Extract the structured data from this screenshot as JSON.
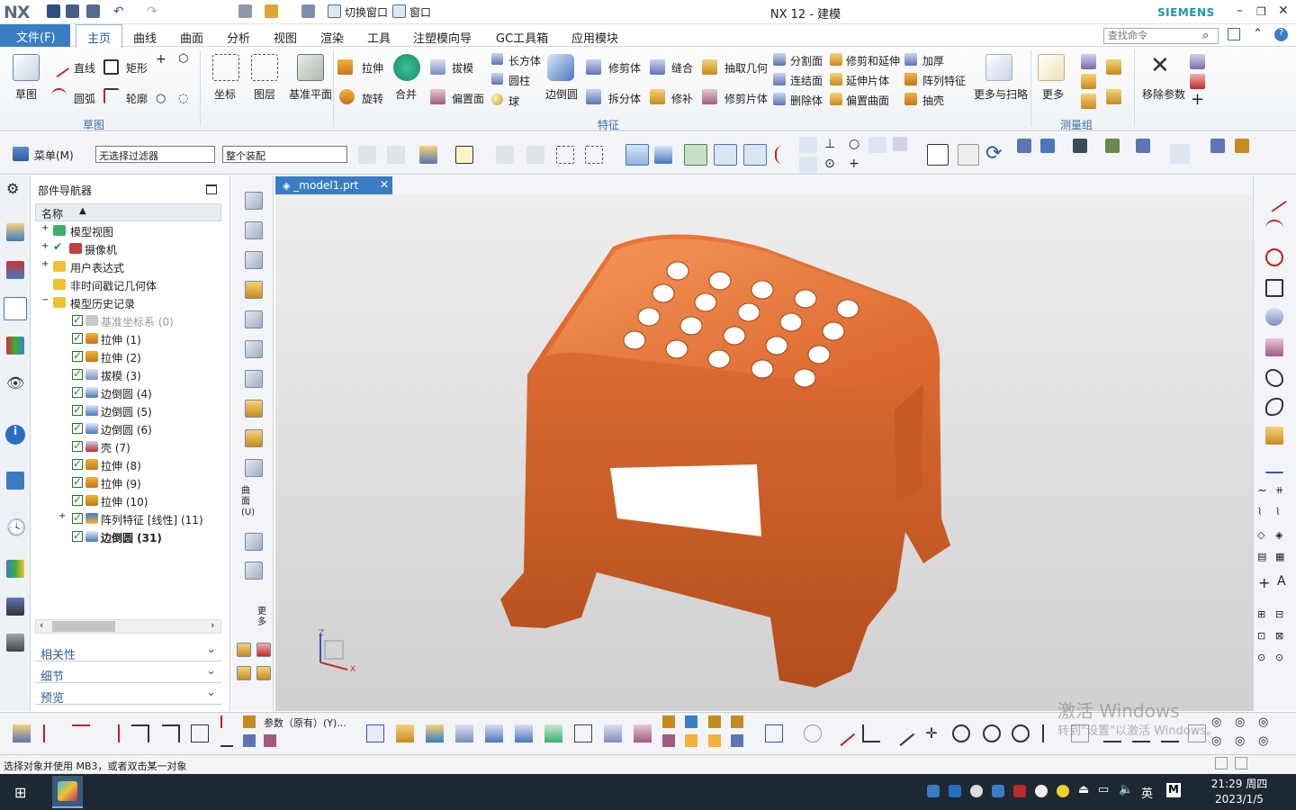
{
  "app": {
    "logo": "NX",
    "title": "NX 12 - 建模",
    "brand": "SIEMENS",
    "switch_window": "切换窗口",
    "window_menu": "窗口"
  },
  "menu": {
    "file": "文件(F)",
    "tabs": [
      "主页",
      "曲线",
      "曲面",
      "分析",
      "视图",
      "渲染",
      "工具",
      "注塑模向导",
      "GC工具箱",
      "应用模块"
    ],
    "search_placeholder": "查找命令"
  },
  "ribbon": {
    "sketch_group": {
      "label": "草图",
      "big": "草图",
      "items": [
        "直线",
        "矩形",
        "圆弧",
        "轮廓"
      ]
    },
    "mid_group": {
      "items": [
        "坐标",
        "图层",
        "基准平面"
      ]
    },
    "feature_group": {
      "label": "特征",
      "items": [
        "拉伸",
        "旋转",
        "合并",
        "拔模",
        "偏置面",
        "长方体",
        "圆柱",
        "球",
        "边倒圆",
        "修剪体",
        "拆分体",
        "缝合",
        "修补",
        "抽取几何",
        "修剪片体",
        "分割面",
        "连结面",
        "删除体",
        "修剪和延伸",
        "延伸片体",
        "偏置曲面",
        "加厚",
        "阵列特征",
        "抽壳",
        "更多与扫略",
        "更多"
      ]
    },
    "measure_group": {
      "label": "测量组",
      "items": [
        "移除参数"
      ]
    }
  },
  "toolbar": {
    "menu": "菜单(M)",
    "filter": "无选择过滤器",
    "assembly": "整个装配"
  },
  "navigator": {
    "title": "部件导航器",
    "column": "名称",
    "roots": [
      "模型视图",
      "摄像机",
      "用户表达式",
      "非时间戳记几何体",
      "模型历史记录"
    ],
    "history": [
      "基准坐标系 (0)",
      "拉伸 (1)",
      "拉伸 (2)",
      "拔模 (3)",
      "边倒圆 (4)",
      "边倒圆 (5)",
      "边倒圆 (6)",
      "壳 (7)",
      "拉伸 (8)",
      "拉伸 (9)",
      "拉伸 (10)",
      "阵列特征 [线性] (11)",
      "边倒圆 (31)"
    ],
    "panels": [
      "相关性",
      "细节",
      "预览"
    ]
  },
  "midbar": {
    "label1": "曲面(U)",
    "label2": "更多"
  },
  "document": {
    "tab": "_model1.prt"
  },
  "bottom": {
    "params": "参数（原有）(Y)..."
  },
  "status": {
    "text": "选择对象并使用 MB3，或者双击某一对象"
  },
  "watermark": {
    "line1": "激活 Windows",
    "line2": "转到\"设置\"以激活 Windows。"
  },
  "axis": {
    "z": "Z",
    "x": "X"
  },
  "taskbar": {
    "time": "21:29 周四",
    "date": "2023/1/5",
    "ime": "英"
  },
  "colors": {
    "accent": "#3a7dc4",
    "model": "#e8753a"
  }
}
